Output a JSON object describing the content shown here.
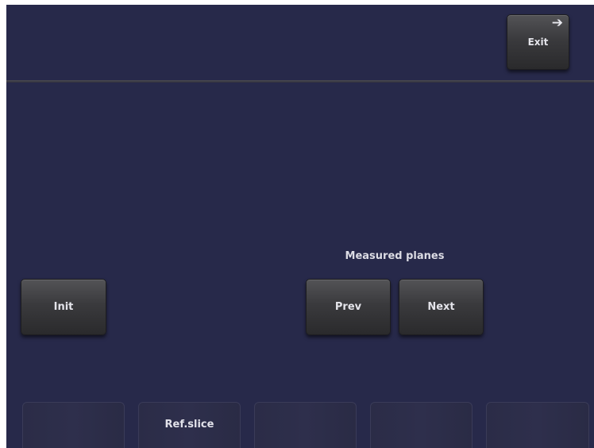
{
  "header": {
    "exit_label": "Exit",
    "exit_icon": "arrow-right-icon"
  },
  "controls": {
    "init_label": "Init",
    "measured_planes_label": "Measured planes",
    "prev_label": "Prev",
    "next_label": "Next"
  },
  "softkeys": [
    "",
    "Ref.slice",
    "",
    "",
    ""
  ],
  "colors": {
    "background": "#27294a",
    "button": "#3a3a3d",
    "text": "#e4e4ea"
  }
}
